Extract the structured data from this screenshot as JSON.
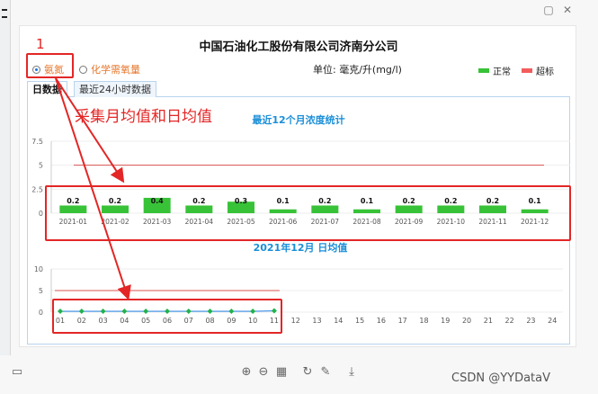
{
  "window": {
    "close_glyph": "✕",
    "restore_glyph": "▢",
    "icons": [
      "restore-icon",
      "close-icon"
    ]
  },
  "header": {
    "title": "中国石油化工股份有限公司济南分公司",
    "radio_ammonia": "氨氮",
    "radio_cod": "化学需氧量",
    "unit_label": "单位: 毫克/升(mg/l)",
    "legend_normal": "正常",
    "legend_exceed": "超标",
    "colors": {
      "normal": "#38c238",
      "exceed": "#f25c5c",
      "accent": "#e6762b"
    }
  },
  "tabs": [
    {
      "label": "日数据",
      "active": true
    },
    {
      "label": "最近24小时数据",
      "active": false
    }
  ],
  "annotations": {
    "number": "1",
    "text": "采集月均值和日均值",
    "color": "#e32626"
  },
  "chart_data": [
    {
      "type": "bar",
      "title": "最近12个月浓度统计",
      "categories": [
        "2021-01",
        "2021-02",
        "2021-03",
        "2021-04",
        "2021-05",
        "2021-06",
        "2021-07",
        "2021-08",
        "2021-09",
        "2021-10",
        "2021-11",
        "2021-12"
      ],
      "series": [
        {
          "values": [
            0.2,
            0.2,
            0.4,
            0.2,
            0.3,
            0.1,
            0.2,
            0.1,
            0.2,
            0.2,
            0.2,
            0.1
          ]
        }
      ],
      "value_labels": [
        "0.2",
        "0.2",
        "0.4",
        "0.2",
        "0.3",
        "0.1",
        "0.2",
        "0.1",
        "0.2",
        "0.2",
        "0.2",
        "0.1"
      ],
      "limit": 5,
      "yticks": [
        "7.5",
        "5",
        "2.5",
        "0"
      ],
      "ylim": [
        0,
        7.5
      ],
      "bar_color": "#38c238",
      "limit_color": "#d9534f",
      "grid": true
    },
    {
      "type": "line",
      "title": "2021年12月 日均值",
      "categories": [
        "01",
        "02",
        "03",
        "04",
        "05",
        "06",
        "07",
        "08",
        "09",
        "10",
        "11",
        "12",
        "13",
        "14",
        "15",
        "16",
        "17",
        "18",
        "19",
        "20",
        "21",
        "22",
        "23",
        "24"
      ],
      "series": [
        {
          "values": [
            0.2,
            0.2,
            0.2,
            0.2,
            0.2,
            0.2,
            0.2,
            0.2,
            0.2,
            0.2,
            0.3
          ]
        }
      ],
      "limit": 5,
      "limit_days": 11,
      "yticks": [
        "10",
        "5",
        "0"
      ],
      "ylim": [
        0,
        10
      ],
      "line_color": "#3a8ee6",
      "point_color": "#22b14c",
      "limit_color": "#d9534f",
      "grid": true
    }
  ],
  "toolbar": {
    "icons": [
      "sidebar-icon",
      "zoom-in-icon",
      "zoom-out-icon",
      "fit-page-icon",
      "rotate-icon",
      "draw-icon",
      "download-icon"
    ],
    "glyphs": {
      "sidebar": "▭",
      "zoom_in": "⊕",
      "zoom_out": "⊖",
      "fit": "▦",
      "rotate": "↻",
      "draw": "✎",
      "download": "⤓"
    }
  },
  "watermark": "CSDN @YYDataV"
}
